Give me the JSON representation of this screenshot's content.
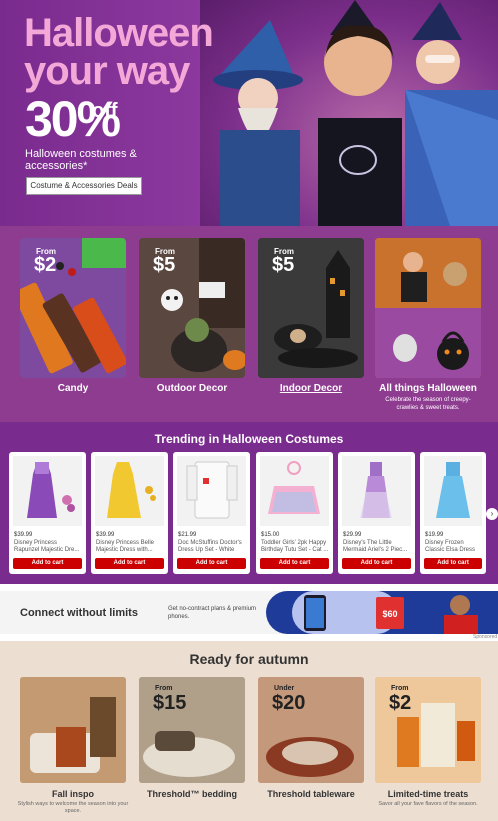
{
  "hero": {
    "title_line1": "Halloween",
    "title_line2": "your way",
    "discount": "30%",
    "discount_suffix": "off",
    "subtitle": "Halloween costumes & accessories*",
    "button_label": "Costume & Accessories Deals"
  },
  "categories": [
    {
      "from": "From",
      "price": "$2",
      "label": "Candy",
      "sub": ""
    },
    {
      "from": "From",
      "price": "$5",
      "label": "Outdoor Decor",
      "sub": ""
    },
    {
      "from": "From",
      "price": "$5",
      "label": "Indoor Decor",
      "sub": ""
    },
    {
      "from": "",
      "price": "",
      "label": "All things Halloween",
      "sub": "Celebrate the season of creepy-crawlies & sweet treats."
    }
  ],
  "trending": {
    "title": "Trending in Halloween Costumes",
    "add_label": "Add to cart",
    "items": [
      {
        "price": "$39.99",
        "name": "Disney Princess Rapunzel Majestic Dre..."
      },
      {
        "price": "$39.99",
        "name": "Disney Princess Belle Majestic Dress with..."
      },
      {
        "price": "$21.99",
        "name": "Doc McStuffins Doctor's Dress Up Set - White"
      },
      {
        "price": "$15.00",
        "name": "Toddler Girls' 2pk Happy Birthday Tutu Set - Cat ..."
      },
      {
        "price": "$29.99",
        "name": "Disney's The Little Mermaid Ariel's 2 Piec..."
      },
      {
        "price": "$19.99",
        "name": "Disney Frozen Classic Elsa Dress"
      }
    ]
  },
  "ad": {
    "title": "Connect without limits",
    "subtitle": "Get no-contract plans & premium phones.",
    "card_price": "$60",
    "sponsored": "Sponsored"
  },
  "autumn": {
    "title": "Ready for autumn",
    "cards": [
      {
        "from": "",
        "price": "",
        "label": "Fall inspo",
        "sub": "Stylish ways to welcome the season into your space."
      },
      {
        "from": "From",
        "price": "$15",
        "label": "Threshold™ bedding",
        "sub": ""
      },
      {
        "from": "Under",
        "price": "$20",
        "label": "Threshold tableware",
        "sub": ""
      },
      {
        "from": "From",
        "price": "$2",
        "label": "Limited-time treats",
        "sub": "Savor all your fave flavors of the season."
      }
    ]
  },
  "colors": {
    "hero_bg": "#7a2b8e",
    "accent_pink": "#f4a8d8",
    "cta_red": "#cc0000"
  }
}
